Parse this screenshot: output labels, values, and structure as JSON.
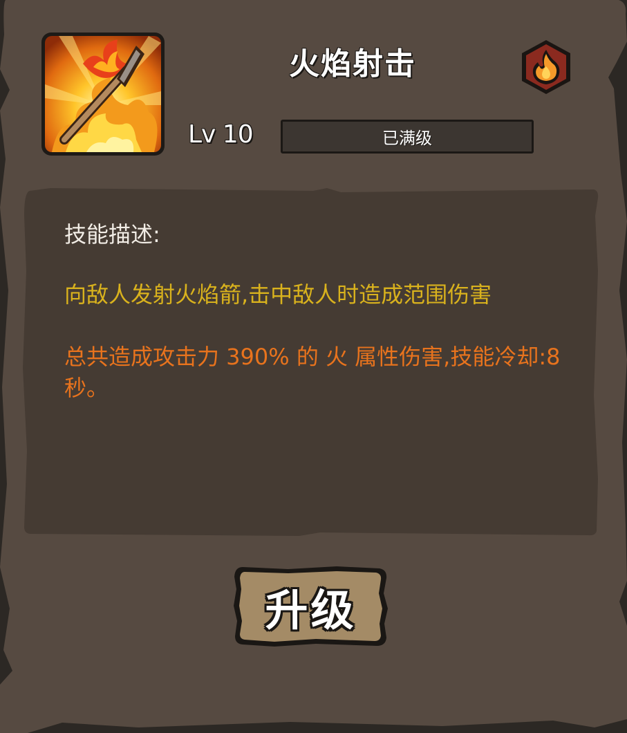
{
  "skill": {
    "title": "火焰射击",
    "icon": "flaming-spear-icon",
    "element_icon": "fire-element-icon",
    "level_label": "Lv 10",
    "level_status": "已满级",
    "level_progress": 1.0
  },
  "description": {
    "heading": "技能描述:",
    "effect": "向敌人发射火焰箭,击中敌人时造成范围伤害",
    "stats": "总共造成攻击力 390% 的 火 属性伤害,技能冷却:8秒。"
  },
  "actions": {
    "upgrade_label": "升级"
  },
  "colors": {
    "panel": "#564a41",
    "description_box": "#453b33",
    "effect_text": "#d9b21d",
    "stats_text": "#e8731d",
    "button": "#a48b66",
    "fire_badge": "#8b2a1f"
  }
}
